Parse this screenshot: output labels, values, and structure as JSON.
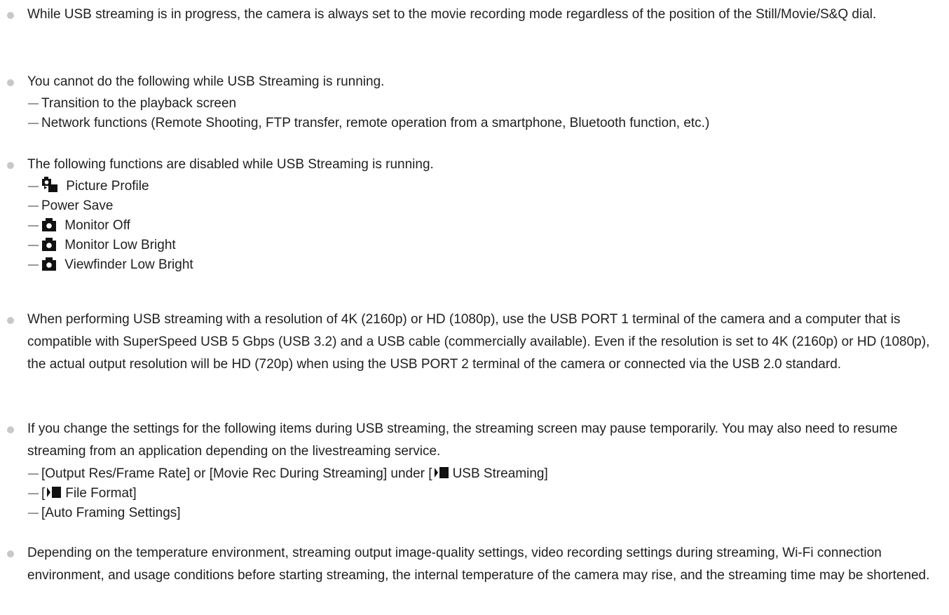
{
  "notes": [
    {
      "text": "While USB streaming is in progress, the camera is always set to the movie recording mode regardless of the position of the Still/Movie/S&Q dial."
    },
    {
      "text": "You cannot do the following while USB Streaming is running.",
      "items": [
        "Transition to the playback screen",
        "Network functions (Remote Shooting, FTP transfer, remote operation from a smartphone, Bluetooth function, etc.)"
      ]
    },
    {
      "text": "The following functions are disabled while USB Streaming is running.",
      "items": [
        {
          "icon": "photo-movie-icon",
          "label": "Picture Profile"
        },
        {
          "label": "Power Save"
        },
        {
          "icon": "camera-icon",
          "label": "Monitor Off"
        },
        {
          "icon": "camera-icon",
          "label": "Monitor Low Bright"
        },
        {
          "icon": "camera-icon",
          "label": "Viewfinder Low Bright"
        }
      ]
    },
    {
      "text": "When performing USB streaming with a resolution of 4K (2160p) or HD (1080p), use the USB PORT 1 terminal of the camera and a computer that is compatible with SuperSpeed USB 5 Gbps (USB 3.2) and a USB cable (commercially available). Even if the resolution is set to 4K (2160p) or HD (1080p), the actual output resolution will be HD (720p) when using the USB PORT 2 terminal of the camera or connected via the USB 2.0 standard."
    },
    {
      "text": "If you change the settings for the following items during USB streaming, the streaming screen may pause temporarily. You may also need to resume streaming from an application depending on the livestreaming service.",
      "items": [
        {
          "before": "[Output Res/Frame Rate] or [Movie Rec During Streaming] under [",
          "icon": "movie-icon",
          "after": "USB Streaming]"
        },
        {
          "before": "[",
          "icon": "movie-icon",
          "after": "File Format]"
        },
        {
          "before": "[Auto Framing Settings]"
        }
      ]
    },
    {
      "text": "Depending on the temperature environment, streaming output image-quality settings, video recording settings during streaming, Wi-Fi connection environment, and usage conditions before starting streaming, the internal temperature of the camera may rise, and the streaming time may be shortened."
    }
  ],
  "colors": {
    "text": "#1f1f1f",
    "bullet": "#c8c8c8",
    "dash": "#9a9a9a",
    "icon": "#111111"
  }
}
